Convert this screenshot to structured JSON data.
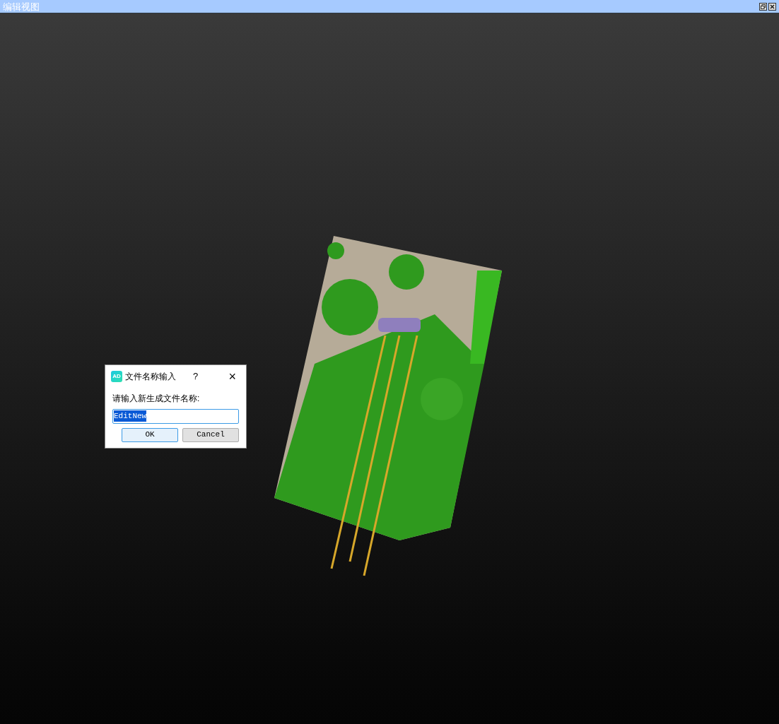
{
  "window": {
    "title": "编辑视图"
  },
  "dialog": {
    "logo_text": "AD",
    "title": "文件名称输入",
    "help": "?",
    "close": "×",
    "prompt": "请输入新生成文件名称:",
    "value": "EditNew",
    "value_selected": true,
    "buttons": [
      {
        "label": "OK",
        "default": true
      },
      {
        "label": "Cancel",
        "default": false
      }
    ]
  }
}
